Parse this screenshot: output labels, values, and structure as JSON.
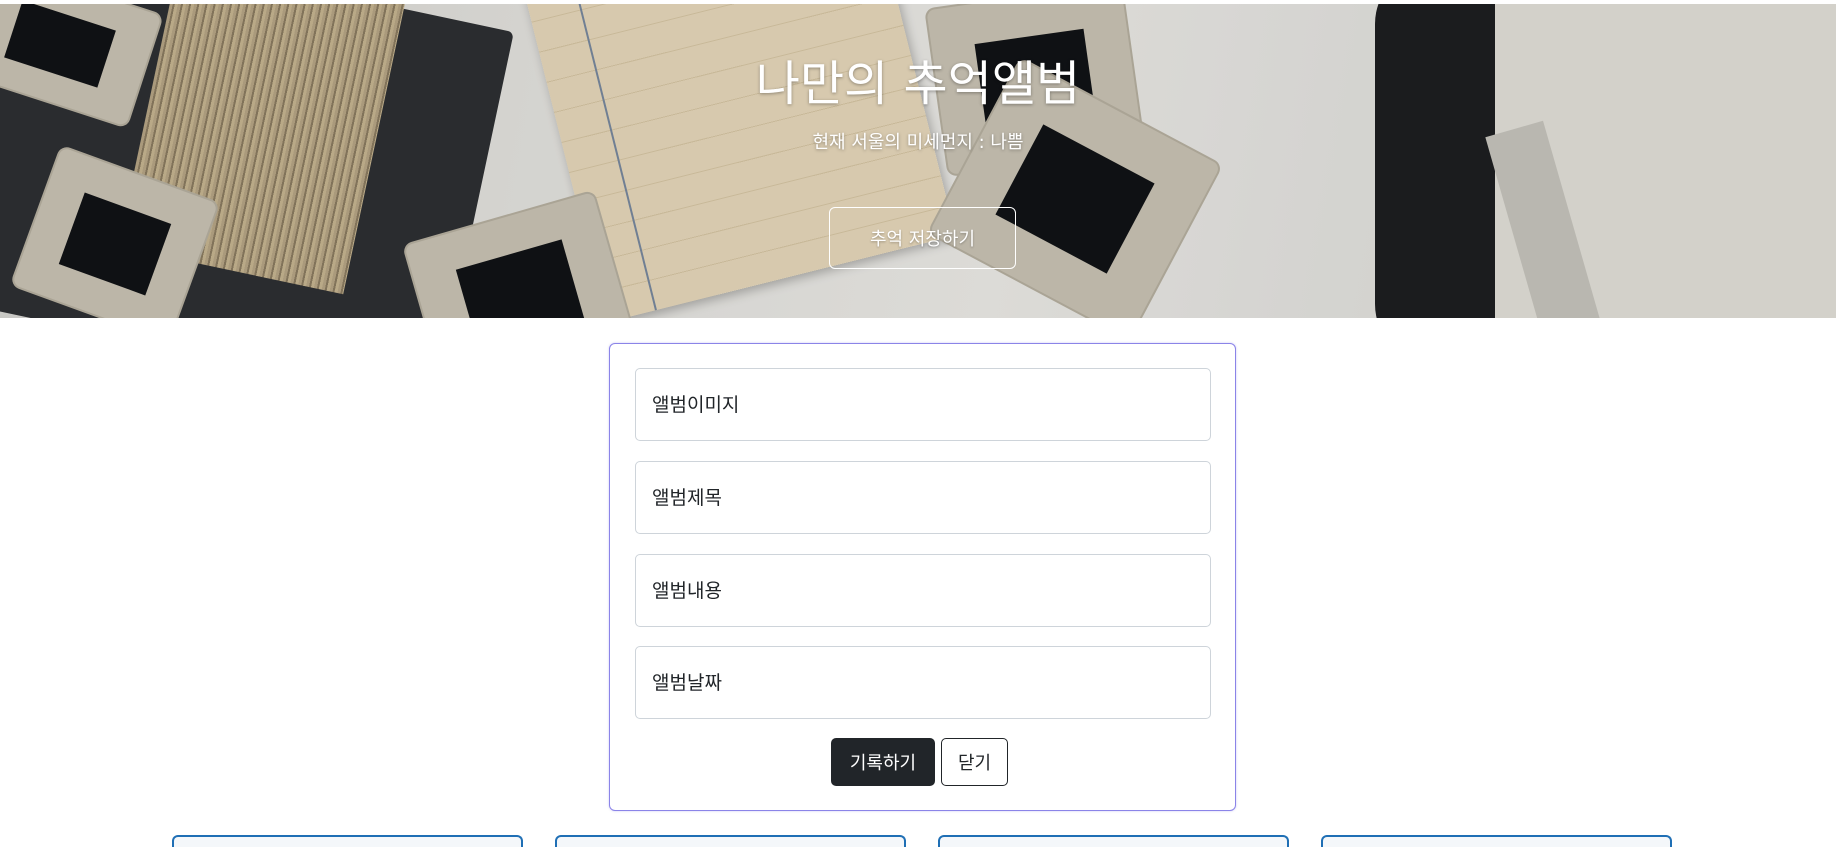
{
  "hero": {
    "title": "나만의 추억앨범",
    "subtitle": "현재 서울의 미세먼지 : 나쁨",
    "button_label": "추억 저장하기"
  },
  "form": {
    "fields": [
      {
        "placeholder": "앨범이미지",
        "value": ""
      },
      {
        "placeholder": "앨범제목",
        "value": ""
      },
      {
        "placeholder": "앨범내용",
        "value": ""
      },
      {
        "placeholder": "앨범날짜",
        "value": ""
      }
    ],
    "save_label": "기록하기",
    "close_label": "닫기"
  },
  "colors": {
    "form_border": "#8b84e8",
    "primary_button": "#212529",
    "card_border": "#1f6fb5"
  }
}
